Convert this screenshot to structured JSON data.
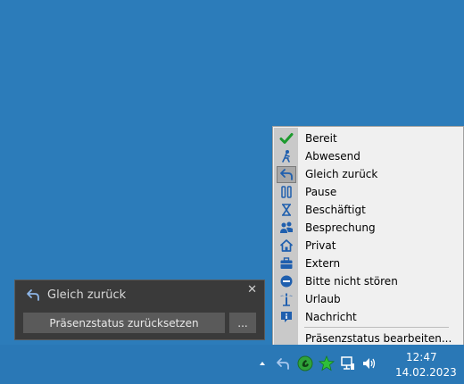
{
  "menu": {
    "items": [
      {
        "label": "Bereit",
        "icon": "check-icon"
      },
      {
        "label": "Abwesend",
        "icon": "person-away-icon"
      },
      {
        "label": "Gleich zurück",
        "icon": "back-arrow-icon"
      },
      {
        "label": "Pause",
        "icon": "pause-icon"
      },
      {
        "label": "Beschäftigt",
        "icon": "hourglass-icon"
      },
      {
        "label": "Besprechung",
        "icon": "meeting-icon"
      },
      {
        "label": "Privat",
        "icon": "home-icon"
      },
      {
        "label": "Extern",
        "icon": "briefcase-icon"
      },
      {
        "label": "Bitte nicht stören",
        "icon": "do-not-disturb-icon"
      },
      {
        "label": "Urlaub",
        "icon": "palm-tree-icon"
      },
      {
        "label": "Nachricht",
        "icon": "message-icon"
      }
    ],
    "edit_label": "Präsenzstatus bearbeiten...",
    "checked_item": "Gleich zurück"
  },
  "popup": {
    "title": "Gleich zurück",
    "close": "✕",
    "reset_button": "Präsenzstatus zurücksetzen",
    "more_button": "..."
  },
  "taskbar": {
    "time": "12:47",
    "date": "14.02.2023"
  },
  "colors": {
    "desktop": "#2c7cba",
    "accent_blue": "#1f5fae",
    "check_green": "#1d9a2e"
  }
}
